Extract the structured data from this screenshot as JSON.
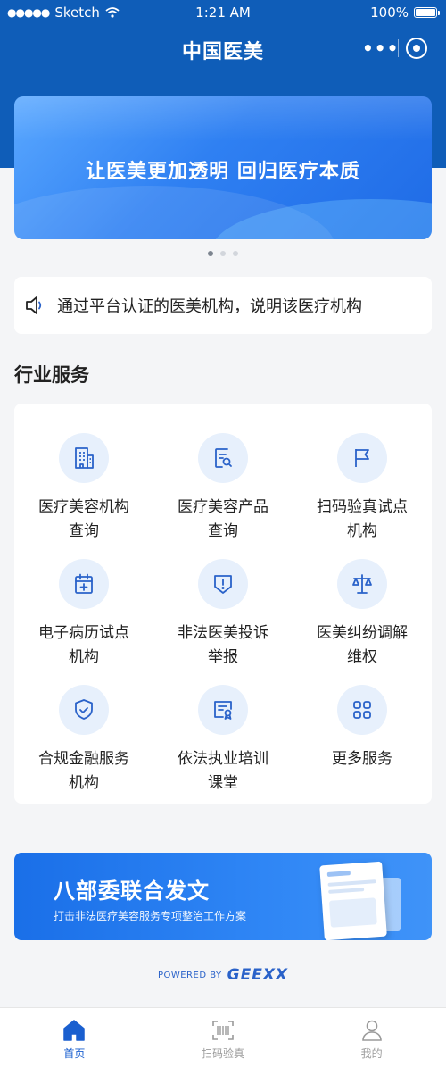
{
  "status_bar": {
    "carrier": "Sketch",
    "time": "1:21 AM",
    "battery": "100%"
  },
  "nav": {
    "title": "中国医美",
    "more_icon": "more-dots-icon",
    "close_icon": "target-circle-icon"
  },
  "banner": {
    "text": "让医美更加透明  回归医疗本质",
    "pages": 3,
    "active_page": 1
  },
  "notice": {
    "icon": "speaker-icon",
    "text": "通过平台认证的医美机构，说明该医疗机构"
  },
  "section": {
    "title": "行业服务"
  },
  "services": [
    {
      "label": "医疗美容机构\n查询",
      "icon": "building-icon"
    },
    {
      "label": "医疗美容产品\n查询",
      "icon": "document-search-icon"
    },
    {
      "label": "扫码验真试点\n机构",
      "icon": "flag-icon"
    },
    {
      "label": "电子病历试点\n机构",
      "icon": "calendar-plus-icon"
    },
    {
      "label": "非法医美投诉\n举报",
      "icon": "shield-alert-icon"
    },
    {
      "label": "医美纠纷调解\n维权",
      "icon": "scale-icon"
    },
    {
      "label": "合规金融服务\n机构",
      "icon": "shield-check-icon"
    },
    {
      "label": "依法执业培训\n课堂",
      "icon": "certificate-icon"
    },
    {
      "label": "更多服务",
      "icon": "grid-icon"
    }
  ],
  "promo": {
    "title": "八部委联合发文",
    "subtitle": "打击非法医疗美容服务专项整治工作方案"
  },
  "powered": {
    "prefix": "POWERED BY",
    "brand": "GEEXX"
  },
  "tabbar": [
    {
      "label": "首页",
      "icon": "home-icon",
      "active": true
    },
    {
      "label": "扫码验真",
      "icon": "scan-icon",
      "active": false
    },
    {
      "label": "我的",
      "icon": "user-icon",
      "active": false
    }
  ],
  "colors": {
    "primary": "#0f5db8",
    "accent": "#1a5fcf",
    "icon": "#2a62c9",
    "icon_bg": "#e7f0fc"
  }
}
